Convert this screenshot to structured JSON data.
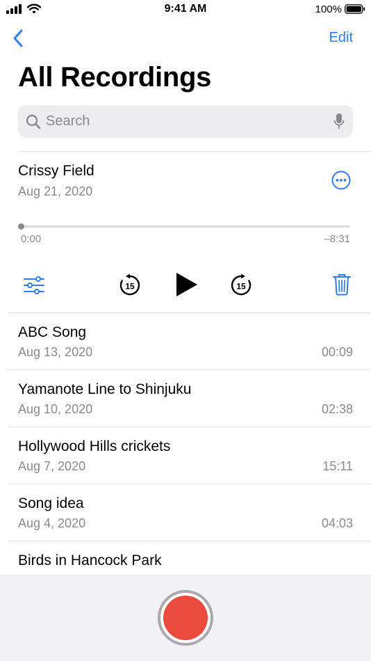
{
  "status_bar": {
    "time": "9:41 AM",
    "battery_percent": "100%"
  },
  "nav": {
    "back_icon": "chevron-left-icon",
    "edit_label": "Edit"
  },
  "title": "All Recordings",
  "search": {
    "placeholder": "Search",
    "value": ""
  },
  "expanded": {
    "title": "Crissy Field",
    "date": "Aug 21, 2020",
    "elapsed": "0:00",
    "remaining": "–8:31",
    "progress": 0,
    "controls": [
      "edit-options-icon",
      "skip-back-15-icon",
      "play-icon",
      "skip-forward-15-icon",
      "trash-icon"
    ],
    "skip_seconds": "15"
  },
  "recordings": [
    {
      "title": "ABC Song",
      "date": "Aug 13, 2020",
      "duration": "00:09"
    },
    {
      "title": "Yamanote Line to Shinjuku",
      "date": "Aug 10, 2020",
      "duration": "02:38"
    },
    {
      "title": "Hollywood Hills crickets",
      "date": "Aug 7, 2020",
      "duration": "15:11"
    },
    {
      "title": "Song idea",
      "date": "Aug 4, 2020",
      "duration": "04:03"
    },
    {
      "title": "Birds in Hancock Park",
      "date": "",
      "duration": ""
    }
  ],
  "colors": {
    "accent": "#2f7cf6",
    "record": "#eb4b3d",
    "secondary_text": "#8a8a8e",
    "bottom_panel": "#f2f2f6"
  }
}
